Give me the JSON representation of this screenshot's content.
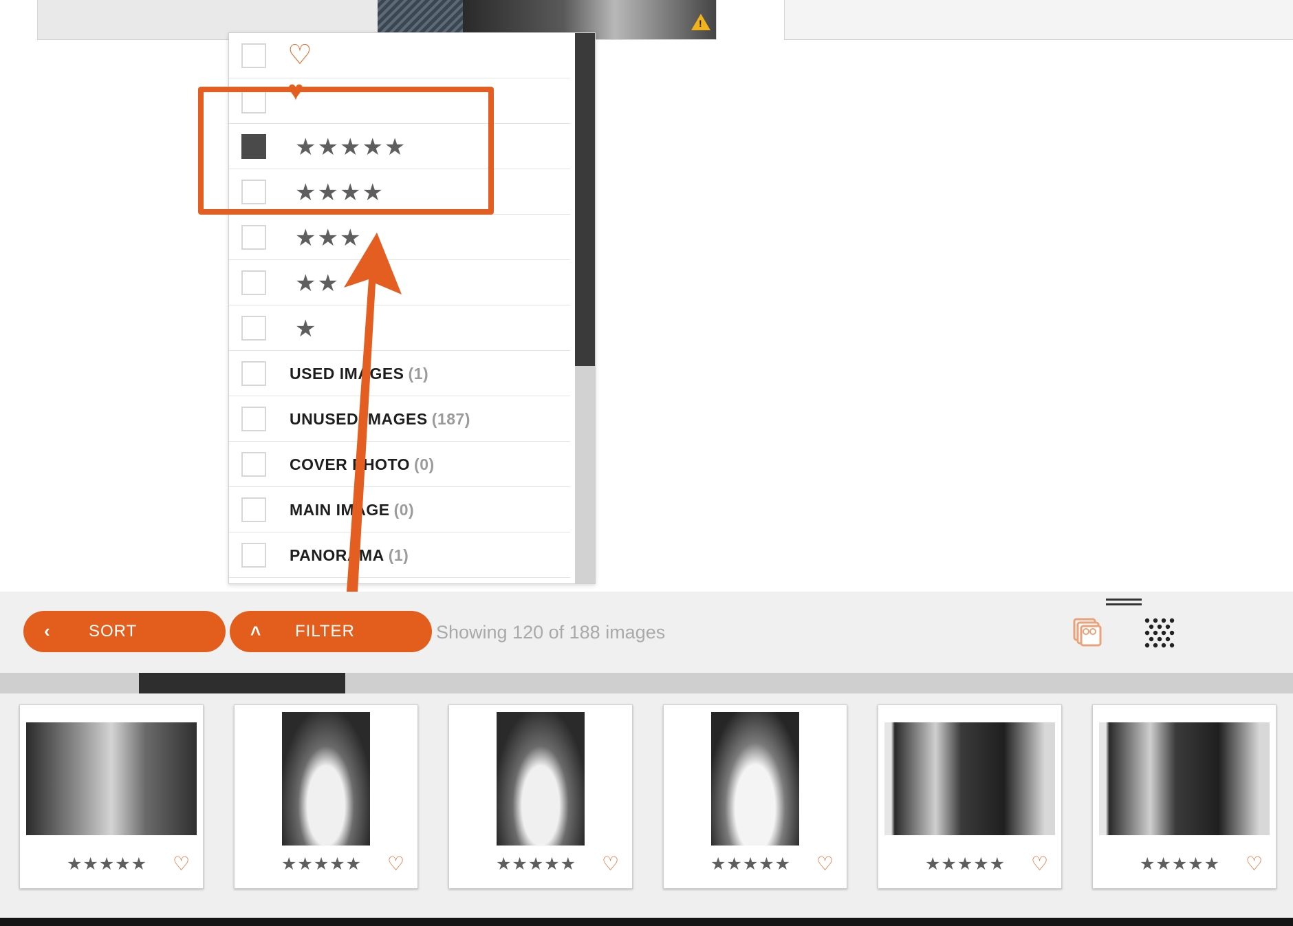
{
  "filter_menu": {
    "rows": [
      {
        "type": "heart-outline",
        "checked": false
      },
      {
        "type": "heart-filled",
        "checked": false
      },
      {
        "type": "stars",
        "stars": "★★★★★",
        "checked": true
      },
      {
        "type": "stars",
        "stars": "★★★★",
        "checked": false
      },
      {
        "type": "stars",
        "stars": "★★★",
        "checked": false
      },
      {
        "type": "stars",
        "stars": "★★",
        "checked": false
      },
      {
        "type": "stars",
        "stars": "★",
        "checked": false
      }
    ],
    "labels": [
      {
        "label": "USED IMAGES",
        "count": "(1)"
      },
      {
        "label": "UNUSED IMAGES",
        "count": "(187)"
      },
      {
        "label": "COVER PHOTO",
        "count": "(0)"
      },
      {
        "label": "MAIN IMAGE",
        "count": "(0)"
      },
      {
        "label": "PANORAMA",
        "count": "(1)"
      }
    ],
    "heart_glyph": "♡",
    "heart_filled_glyph": "♥"
  },
  "toolbar": {
    "sort_label": "SORT",
    "sort_chevron": "‹",
    "filter_label": "FILTER",
    "filter_chevron": "˄",
    "showing_text": "Showing 120 of 188 images"
  },
  "thumbnails": {
    "stars": "★★★★★",
    "heart": "♡",
    "items": [
      "landscape",
      "portrait",
      "portrait",
      "portrait",
      "landscape",
      "landscape"
    ]
  },
  "colors": {
    "accent": "#e35e1c",
    "annotation": "#e35e20",
    "star": "#5e5e5e",
    "muted_text": "#a9a9a9"
  },
  "icons": {
    "warning": "warning-icon",
    "stack": "image-stack-icon",
    "grid": "grid-dots-icon"
  }
}
